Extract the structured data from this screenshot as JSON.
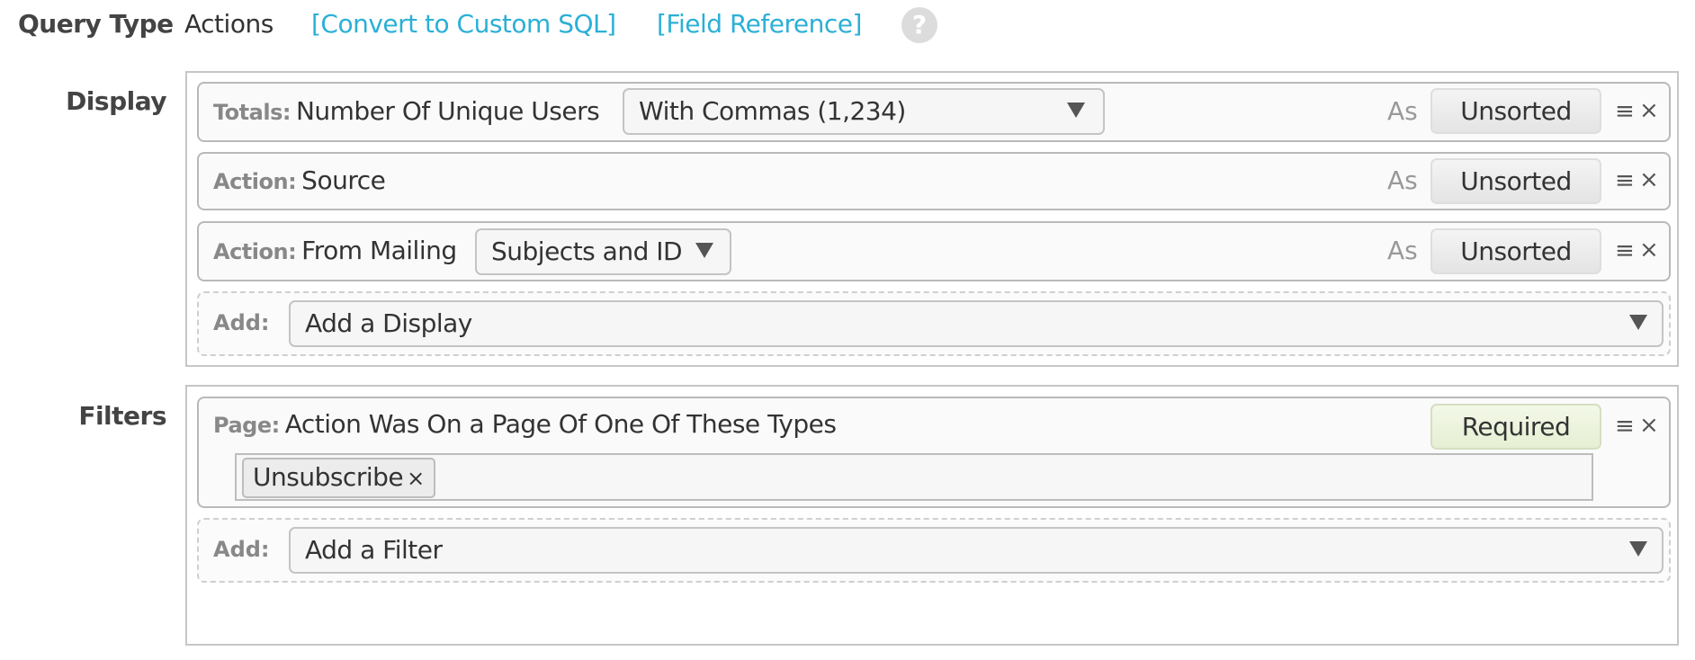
{
  "header": {
    "query_type_label": "Query Type",
    "query_type_value": "Actions",
    "convert_link": "[Convert to Custom SQL]",
    "field_reference_link": "[Field Reference]",
    "help_icon": "?",
    "link_color": "#2bb0d6"
  },
  "display": {
    "label": "Display",
    "rows": [
      {
        "category": "Totals:",
        "field": "Number Of Unique Users",
        "format_select": "With Commas (1,234)",
        "as_label": "As",
        "sort": "Unsorted"
      },
      {
        "category": "Action:",
        "field": "Source",
        "as_label": "As",
        "sort": "Unsorted"
      },
      {
        "category": "Action:",
        "field": "From Mailing",
        "format_select": "Subjects and ID",
        "as_label": "As",
        "sort": "Unsorted"
      }
    ],
    "add": {
      "label": "Add:",
      "placeholder": "Add a Display"
    }
  },
  "filters": {
    "label": "Filters",
    "rows": [
      {
        "category": "Page:",
        "field": "Action Was On a Page Of One Of These Types",
        "status": "Required",
        "tags": [
          "Unsubscribe"
        ]
      }
    ],
    "add": {
      "label": "Add:",
      "placeholder": "Add a Filter"
    }
  },
  "icons": {
    "reorder": "≡",
    "remove": "×",
    "tag_remove": "×"
  }
}
